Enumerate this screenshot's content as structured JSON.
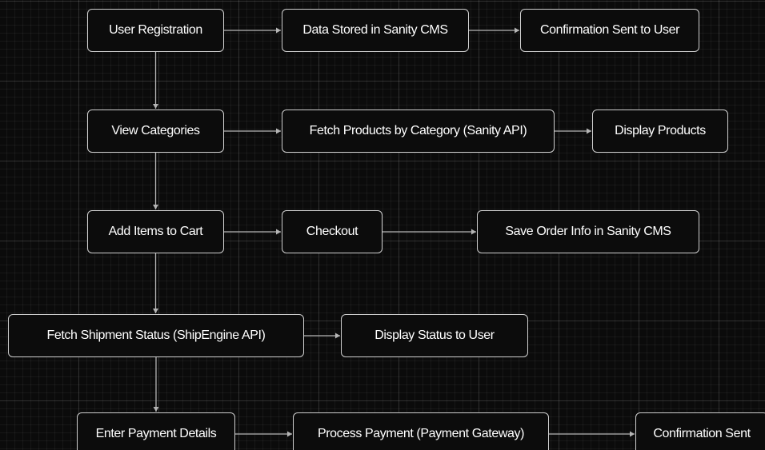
{
  "colors": {
    "background": "#0b0b0b",
    "node_fill": "#0c0c0c",
    "node_border": "#cfcfcf",
    "edge": "#b5b5b5",
    "text": "#ffffff"
  },
  "nodes": {
    "user_registration": "User Registration",
    "data_stored": "Data Stored in Sanity CMS",
    "confirmation_sent_to_user": "Confirmation Sent to User",
    "view_categories": "View Categories",
    "fetch_products": "Fetch Products by Category (Sanity API)",
    "display_products": "Display Products",
    "add_items_to_cart": "Add Items to Cart",
    "checkout": "Checkout",
    "save_order_info": "Save Order Info in Sanity CMS",
    "fetch_shipment_status": "Fetch Shipment Status (ShipEngine API)",
    "display_status": "Display Status to User",
    "enter_payment_details": "Enter Payment Details",
    "process_payment": "Process Payment (Payment Gateway)",
    "confirmation_sent": "Confirmation Sent"
  },
  "edges": [
    {
      "from": "user_registration",
      "to": "data_stored"
    },
    {
      "from": "data_stored",
      "to": "confirmation_sent_to_user"
    },
    {
      "from": "user_registration",
      "to": "view_categories"
    },
    {
      "from": "view_categories",
      "to": "fetch_products"
    },
    {
      "from": "fetch_products",
      "to": "display_products"
    },
    {
      "from": "view_categories",
      "to": "add_items_to_cart"
    },
    {
      "from": "add_items_to_cart",
      "to": "checkout"
    },
    {
      "from": "checkout",
      "to": "save_order_info"
    },
    {
      "from": "add_items_to_cart",
      "to": "fetch_shipment_status"
    },
    {
      "from": "fetch_shipment_status",
      "to": "display_status"
    },
    {
      "from": "fetch_shipment_status",
      "to": "enter_payment_details"
    },
    {
      "from": "enter_payment_details",
      "to": "process_payment"
    },
    {
      "from": "process_payment",
      "to": "confirmation_sent"
    }
  ]
}
